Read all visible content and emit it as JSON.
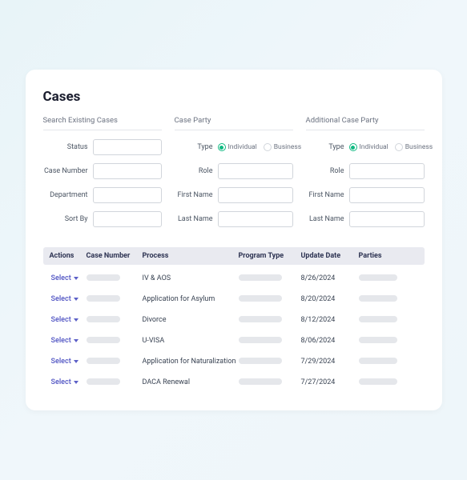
{
  "title": "Cases",
  "sections": {
    "search": {
      "header": "Search Existing Cases",
      "fields": {
        "status_label": "Status",
        "case_number_label": "Case Number",
        "department_label": "Department",
        "sort_by_label": "Sort By"
      }
    },
    "party": {
      "header": "Case Party",
      "type_label": "Type",
      "radio_individual": "Individual",
      "radio_business": "Business",
      "role_label": "Role",
      "first_name_label": "First Name",
      "last_name_label": "Last Name"
    },
    "additional": {
      "header": "Additional Case Party",
      "type_label": "Type",
      "radio_individual": "Individual",
      "radio_business": "Business",
      "role_label": "Role",
      "first_name_label": "First Name",
      "last_name_label": "Last Name"
    }
  },
  "table": {
    "headers": {
      "actions": "Actions",
      "case_number": "Case Number",
      "process": "Process",
      "program_type": "Program Type",
      "update_date": "Update Date",
      "parties": "Parties"
    },
    "select_label": "Select",
    "rows": [
      {
        "process": "IV & AOS",
        "update_date": "8/26/2024"
      },
      {
        "process": "Application for Asylum",
        "update_date": "8/20/2024"
      },
      {
        "process": "Divorce",
        "update_date": "8/12/2024"
      },
      {
        "process": "U-VISA",
        "update_date": "8/06/2024"
      },
      {
        "process": "Application for Naturalization",
        "update_date": "7/29/2024"
      },
      {
        "process": "DACA Renewal",
        "update_date": "7/27/2024"
      }
    ]
  },
  "colors": {
    "accent": "#5b5fc7",
    "radio_selected": "#10b981"
  }
}
